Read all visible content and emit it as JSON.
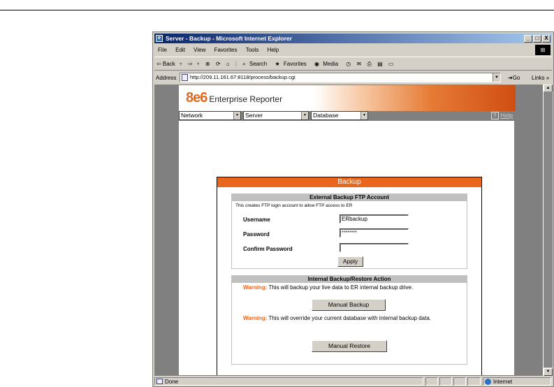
{
  "window": {
    "title": "Server - Backup - Microsoft Internet Explorer",
    "buttons": {
      "minimize": "_",
      "maximize": "□",
      "close": "X"
    }
  },
  "menu": [
    "File",
    "Edit",
    "View",
    "Favorites",
    "Tools",
    "Help"
  ],
  "toolbar": {
    "back": "⇦ Back",
    "forward": "⇨",
    "search": "Search",
    "favorites": "Favorites",
    "media": "Media"
  },
  "address": {
    "label": "Address",
    "url": "http://209.11.161.67:8118/process/backup.cgi",
    "go": "Go",
    "links": "Links »"
  },
  "banner": {
    "brand": "8e6",
    "product": "Enterprise Reporter"
  },
  "nav": {
    "menus": [
      "Network",
      "Server",
      "Database"
    ],
    "help": "Help",
    "help_icon": "?"
  },
  "panel": {
    "title": "Backup",
    "ftp": {
      "heading": "External Backup FTP Account",
      "note": "This creates FTP login account to allow FTP access to ER",
      "username_label": "Username",
      "username_value": "ERbackup",
      "password_label": "Password",
      "password_value": "********",
      "confirm_label": "Confirm Password",
      "confirm_value": "",
      "apply_label": "Apply"
    },
    "internal": {
      "heading": "Internal Backup/Restore Action",
      "warning_word": "Warning:",
      "backup_warning": "This will backup your live data to ER internal backup drive.",
      "backup_button": "Manual Backup",
      "restore_warning": "This will override your current database with internal backup data.",
      "restore_button": "Manual Restore"
    }
  },
  "status": {
    "left": "Done",
    "zone": "Internet"
  },
  "colors": {
    "accent": "#e8671c",
    "titlebar": "#0a246a",
    "section_header": "#c0c0c0"
  }
}
